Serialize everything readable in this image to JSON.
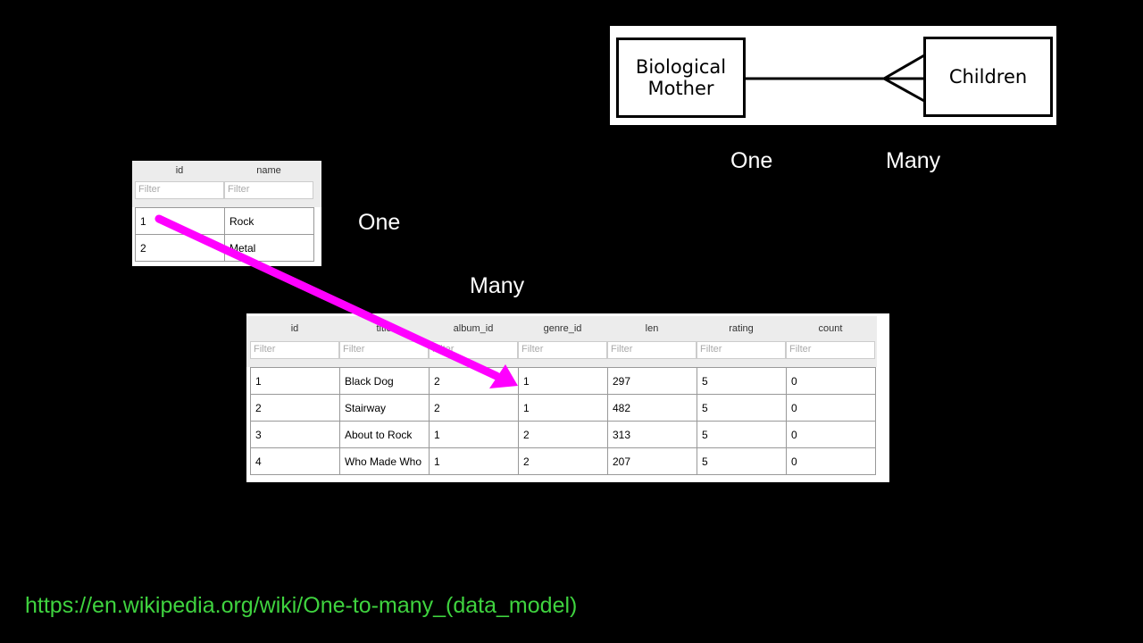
{
  "er_diagram": {
    "left_entity": "Biological Mother",
    "right_entity": "Children"
  },
  "labels": {
    "er_one": "One",
    "er_many": "Many",
    "table_one": "One",
    "table_many": "Many"
  },
  "genres_table": {
    "columns": [
      "id",
      "name"
    ],
    "filter_placeholder": "Filter",
    "rows": [
      [
        "1",
        "Rock"
      ],
      [
        "2",
        "Metal"
      ]
    ]
  },
  "tracks_table": {
    "columns": [
      "id",
      "title",
      "album_id",
      "genre_id",
      "len",
      "rating",
      "count"
    ],
    "filter_placeholder": "Filter",
    "rows": [
      [
        "1",
        "Black Dog",
        "2",
        "1",
        "297",
        "5",
        "0"
      ],
      [
        "2",
        "Stairway",
        "2",
        "1",
        "482",
        "5",
        "0"
      ],
      [
        "3",
        "About to Rock",
        "1",
        "2",
        "313",
        "5",
        "0"
      ],
      [
        "4",
        "Who Made Who",
        "1",
        "2",
        "207",
        "5",
        "0"
      ]
    ]
  },
  "footer": {
    "url": "https://en.wikipedia.org/wiki/One-to-many_(data_model)"
  },
  "colors": {
    "arrow": "#ff00ff",
    "url": "#3fd33f",
    "background": "#000000"
  }
}
